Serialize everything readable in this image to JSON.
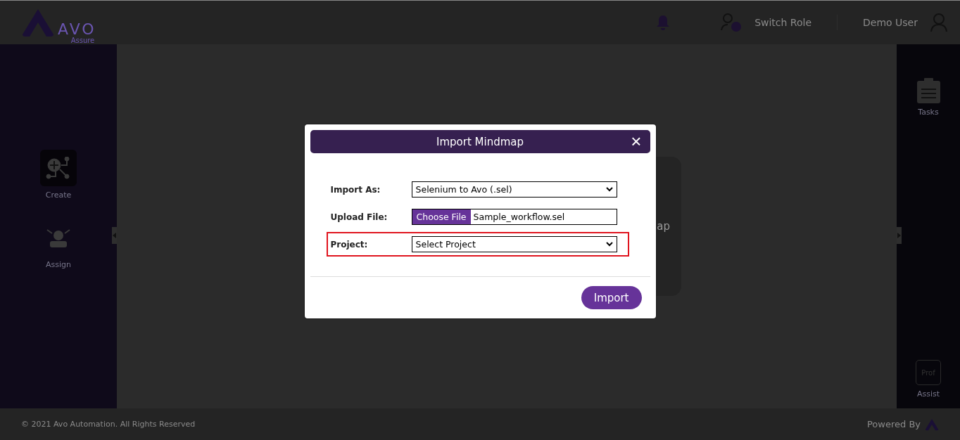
{
  "header": {
    "logo": {
      "name": "AVO",
      "tagline": "Assure"
    },
    "switch_role": "Switch Role",
    "user": "Demo User"
  },
  "left_sidebar": {
    "items": [
      {
        "label": "Create",
        "selected": true,
        "kind": "create"
      },
      {
        "label": "Assign",
        "selected": false,
        "kind": "assign"
      }
    ]
  },
  "right_sidebar": {
    "items": [
      {
        "label": "Tasks",
        "kind": "tasks"
      },
      {
        "label": "Assist",
        "kind": "assist",
        "badge": "Prof"
      }
    ]
  },
  "background_card": {
    "text": "ap"
  },
  "dialog": {
    "title": "Import Mindmap",
    "close": "×",
    "fields": [
      {
        "label": "Import As:",
        "kind": "select",
        "value": "Selenium to Avo (.sel)",
        "highlighted": false
      },
      {
        "label": "Upload File:",
        "kind": "file",
        "button": "Choose File",
        "value": "Sample_workflow.sel",
        "highlighted": false
      },
      {
        "label": "Project:",
        "kind": "select",
        "value": "Select Project",
        "highlighted": true
      }
    ],
    "button": "Import"
  },
  "footer": {
    "copyright": "© 2021 Avo Automation. All Rights Reserved",
    "powered_by": "Powered By"
  }
}
